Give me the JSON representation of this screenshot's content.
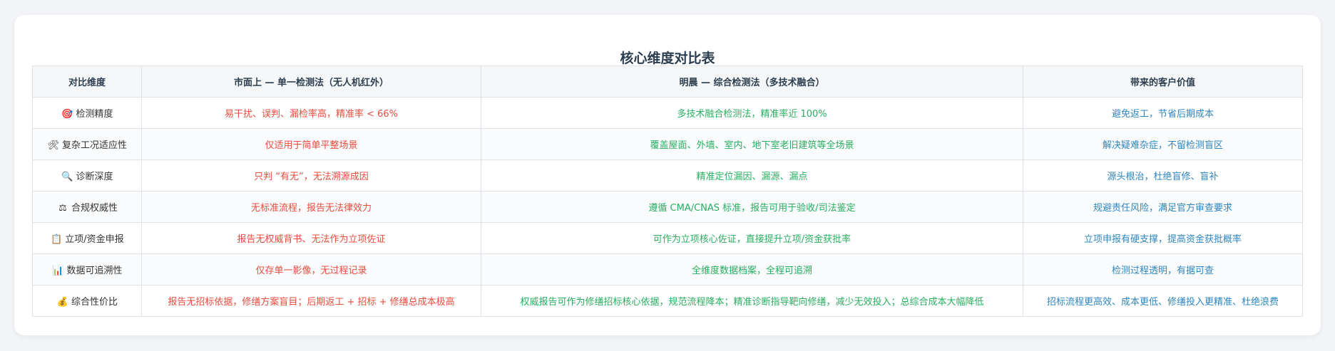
{
  "title": "核心维度对比表",
  "headers": {
    "dimension": "对比维度",
    "market": "市面上 — 单一检测法（无人机红外）",
    "minglang": "明晨 — 综合检测法（多技术融合）",
    "value": "带来的客户价值"
  },
  "rows": [
    {
      "icon": "target-icon",
      "glyph": "🎯",
      "dimension": "检测精度",
      "market": "易干扰、误判、漏检率高，精准率 < 66%",
      "minglang": "多技术融合检测法，精准率近 100%",
      "value": "避免返工，节省后期成本"
    },
    {
      "icon": "tools-icon",
      "glyph": "🛠",
      "dimension": "复杂工况适应性",
      "market": "仅适用于简单平整场景",
      "minglang": "覆盖屋面、外墙、室内、地下室老旧建筑等全场景",
      "value": "解决疑难杂症，不留检测盲区"
    },
    {
      "icon": "magnifier-icon",
      "glyph": "🔍",
      "dimension": "诊断深度",
      "market": "只判 “有无”，无法溯源成因",
      "minglang": "精准定位漏因、漏源、漏点",
      "value": "源头根治，杜绝盲修、盲补"
    },
    {
      "icon": "scales-icon",
      "glyph": "⚖",
      "dimension": "合规权威性",
      "market": "无标准流程，报告无法律效力",
      "minglang": "遵循 CMA/CNAS 标准，报告可用于验收/司法鉴定",
      "value": "规避责任风险，满足官方审查要求"
    },
    {
      "icon": "clipboard-icon",
      "glyph": "📋",
      "dimension": "立项/资金申报",
      "market": "报告无权威背书、无法作为立项佐证",
      "minglang": "可作为立项核心佐证，直接提升立项/资金获批率",
      "value": "立项申报有硬支撑，提高资金获批概率"
    },
    {
      "icon": "bar-chart-icon",
      "glyph": "📊",
      "dimension": "数据可追溯性",
      "market": "仅存单一影像，无过程记录",
      "minglang": "全维度数据档案，全程可追溯",
      "value": "检测过程透明，有据可查"
    },
    {
      "icon": "money-bag-icon",
      "glyph": "💰",
      "dimension": "综合性价比",
      "market": "报告无招标依据，修缮方案盲目；后期返工 + 招标 + 修缮总成本极高",
      "minglang": "权威报告可作为修缮招标核心依据，规范流程降本；精准诊断指导靶向修缮，减少无效投入；总综合成本大幅降低",
      "value": "招标流程更高效、成本更低、修缮投入更精准、杜绝浪费"
    }
  ]
}
